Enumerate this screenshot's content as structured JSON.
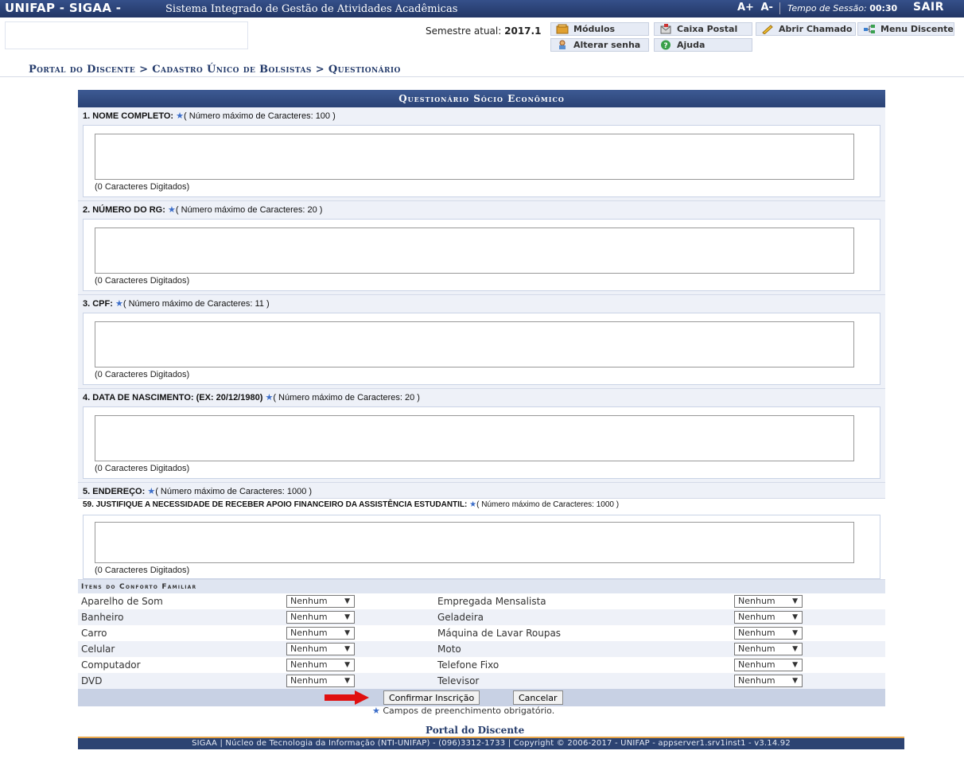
{
  "header": {
    "system_name": "UNIFAP - SIGAA -",
    "system_subtitle": "Sistema Integrado de Gestão de Atividades Acadêmicas",
    "font_increase": "A+",
    "font_decrease": "A-",
    "session_label": "Tempo de Sessão:",
    "session_time": "00:30",
    "logout": "SAIR"
  },
  "toolbar": {
    "semester_label": "Semestre atual:",
    "semester_value": "2017.1",
    "modules": "Módulos",
    "mailbox": "Caixa Postal",
    "open_ticket": "Abrir Chamado",
    "student_menu": "Menu Discente",
    "change_password": "Alterar senha",
    "help": "Ajuda"
  },
  "breadcrumb": "Portal do Discente > Cadastro Único de Bolsistas > Questionário",
  "form": {
    "caption": "Questionário Sócio Econômico",
    "required_star": "★",
    "questions": [
      {
        "label": "1. NOME COMPLETO:",
        "note": "( Número máximo de Caracteres: 100 )",
        "counter": "(0 Caracteres Digitados)"
      },
      {
        "label": "2. NÚMERO DO RG:",
        "note": "( Número máximo de Caracteres: 20 )",
        "counter": "(0 Caracteres Digitados)"
      },
      {
        "label": "3. CPF:",
        "note": "( Número máximo de Caracteres: 11 )",
        "counter": "(0 Caracteres Digitados)"
      },
      {
        "label": "4. DATA DE NASCIMENTO: (EX: 20/12/1980)",
        "note": "( Número máximo de Caracteres: 20 )",
        "counter": "(0 Caracteres Digitados)"
      },
      {
        "label": "5. ENDEREÇO:",
        "note": "( Número máximo de Caracteres: 1000 )",
        "counter": ""
      },
      {
        "label": "59. JUSTIFIQUE A NECESSIDADE DE RECEBER APOIO FINANCEIRO DA ASSISTÊNCIA ESTUDANTIL:",
        "note": "( Número máximo de Caracteres: 1000 )",
        "counter": "(0 Caracteres Digitados)"
      }
    ],
    "items_header": "Itens do Conforto Familiar",
    "items": [
      {
        "left": "Aparelho de Som",
        "left_value": "Nenhum",
        "right": "Empregada Mensalista",
        "right_value": "Nenhum"
      },
      {
        "left": "Banheiro",
        "left_value": "Nenhum",
        "right": "Geladeira",
        "right_value": "Nenhum"
      },
      {
        "left": "Carro",
        "left_value": "Nenhum",
        "right": "Máquina de Lavar Roupas",
        "right_value": "Nenhum"
      },
      {
        "left": "Celular",
        "left_value": "Nenhum",
        "right": "Moto",
        "right_value": "Nenhum"
      },
      {
        "left": "Computador",
        "left_value": "Nenhum",
        "right": "Telefone Fixo",
        "right_value": "Nenhum"
      },
      {
        "left": "DVD",
        "left_value": "Nenhum",
        "right": "Televisor",
        "right_value": "Nenhum"
      }
    ],
    "select_arrow": "▼",
    "confirm_button": "Confirmar Inscrição",
    "cancel_button": "Cancelar",
    "required_note": "Campos de preenchimento obrigatório."
  },
  "footer": {
    "portal_link": "Portal do Discente",
    "text": "SIGAA | Núcleo de Tecnologia da Informação (NTI-UNIFAP) - (096)3312-1733 | Copyright © 2006-2017 - UNIFAP - appserver1.srv1inst1 - v3.14.92"
  },
  "colors": {
    "header_bg": "#2c4372",
    "panel_bg": "#eef1f8",
    "accent_star": "#3b6dc9",
    "footer_border": "#e8a64a",
    "indicator_arrow": "#e01010"
  }
}
